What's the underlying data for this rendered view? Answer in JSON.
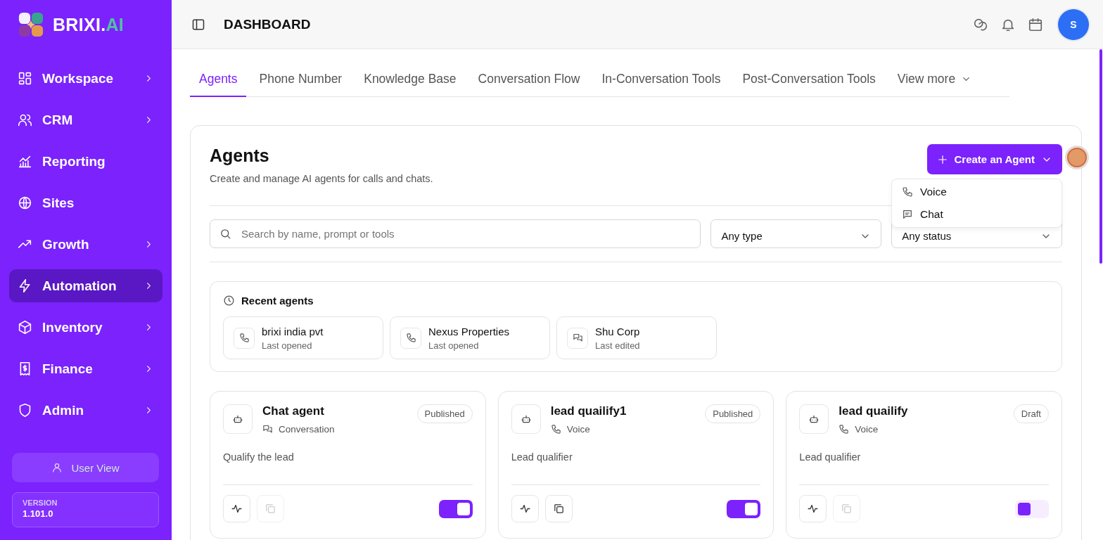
{
  "sidebar": {
    "brand": "BRIXI.",
    "brand_suffix": "AI",
    "items": [
      {
        "label": "Workspace",
        "chevron": true,
        "selected": false
      },
      {
        "label": "CRM",
        "chevron": true,
        "selected": false
      },
      {
        "label": "Reporting",
        "chevron": false,
        "selected": false
      },
      {
        "label": "Sites",
        "chevron": false,
        "selected": false
      },
      {
        "label": "Growth",
        "chevron": true,
        "selected": false
      },
      {
        "label": "Automation",
        "chevron": true,
        "selected": true
      },
      {
        "label": "Inventory",
        "chevron": true,
        "selected": false
      },
      {
        "label": "Finance",
        "chevron": true,
        "selected": false
      },
      {
        "label": "Admin",
        "chevron": true,
        "selected": false
      }
    ],
    "user_view": "User View",
    "version_label": "VERSION",
    "version": "1.101.0"
  },
  "header": {
    "title": "DASHBOARD",
    "avatar": "S"
  },
  "tabs": [
    {
      "label": "Agents",
      "selected": true
    },
    {
      "label": "Phone Number",
      "selected": false
    },
    {
      "label": "Knowledge Base",
      "selected": false
    },
    {
      "label": "Conversation Flow",
      "selected": false
    },
    {
      "label": "In-Conversation Tools",
      "selected": false
    },
    {
      "label": "Post-Conversation Tools",
      "selected": false
    }
  ],
  "view_more": "View more",
  "panel": {
    "title": "Agents",
    "subtitle": "Create and manage AI agents for calls and chats.",
    "create_button": "Create an Agent",
    "create_menu": [
      {
        "label": "Voice",
        "kind": "voice"
      },
      {
        "label": "Chat",
        "kind": "chat"
      }
    ],
    "search": {
      "placeholder": "Search by name, prompt or tools"
    },
    "type_filter": "Any type",
    "status_filter": "Any status",
    "recent_title": "Recent agents",
    "recent": [
      {
        "name": "brixi india pvt",
        "note": "Last opened",
        "kind": "voice"
      },
      {
        "name": "Nexus Properties",
        "note": "Last opened",
        "kind": "voice"
      },
      {
        "name": "Shu Corp",
        "note": "Last edited",
        "kind": "chat"
      }
    ],
    "agents": [
      {
        "name": "Chat agent",
        "channel": "Conversation",
        "kind": "chat",
        "status": "Published",
        "description": "Qualify the lead",
        "copy_disabled": true,
        "on": true
      },
      {
        "name": "lead quailify1",
        "channel": "Voice",
        "kind": "voice",
        "status": "Published",
        "description": "Lead qualifier",
        "copy_disabled": false,
        "on": true
      },
      {
        "name": "lead quailify",
        "channel": "Voice",
        "kind": "voice",
        "status": "Draft",
        "description": "Lead qualifier",
        "copy_disabled": true,
        "on": false
      }
    ]
  }
}
